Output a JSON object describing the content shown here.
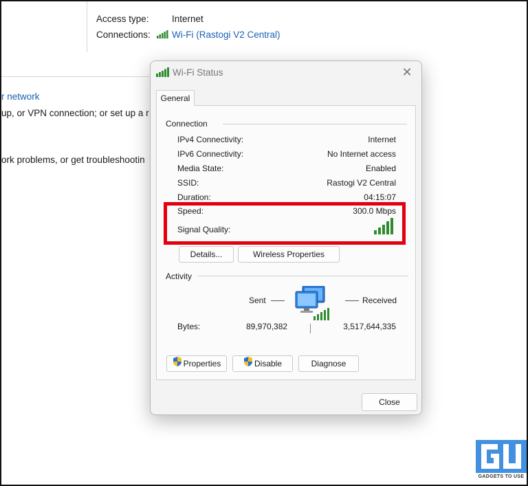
{
  "background": {
    "access_type_label": "Access type:",
    "access_type_value": "Internet",
    "connections_label": "Connections:",
    "connections_value": "Wi-Fi (Rastogi V2 Central)",
    "link_fragment": "r network",
    "text_fragment_1": "up, or VPN connection; or set up a r",
    "text_fragment_2": "ork problems, or get troubleshootin"
  },
  "dialog": {
    "title": "Wi-Fi Status",
    "tab": "General",
    "connection": {
      "heading": "Connection",
      "rows": [
        {
          "label": "IPv4 Connectivity:",
          "value": "Internet"
        },
        {
          "label": "IPv6 Connectivity:",
          "value": "No Internet access"
        },
        {
          "label": "Media State:",
          "value": "Enabled"
        },
        {
          "label": "SSID:",
          "value": "Rastogi V2 Central"
        },
        {
          "label": "Duration:",
          "value": "04:15:07"
        },
        {
          "label": "Speed:",
          "value": "300.0 Mbps"
        },
        {
          "label": "Signal Quality:",
          "value": ""
        }
      ],
      "signal_bars": 5
    },
    "buttons": {
      "details": "Details...",
      "wireless_properties": "Wireless Properties",
      "properties": "Properties",
      "disable": "Disable",
      "diagnose": "Diagnose",
      "close": "Close"
    },
    "activity": {
      "heading": "Activity",
      "sent_label": "Sent",
      "received_label": "Received",
      "bytes_label": "Bytes:",
      "bytes_sent": "89,970,382",
      "bytes_received": "3,517,644,335"
    }
  },
  "watermark": {
    "text": "GADGETS TO USE"
  },
  "colors": {
    "highlight": "#e3000f",
    "signal_green": "#2e8b2e",
    "link_blue": "#1a5fb4"
  }
}
